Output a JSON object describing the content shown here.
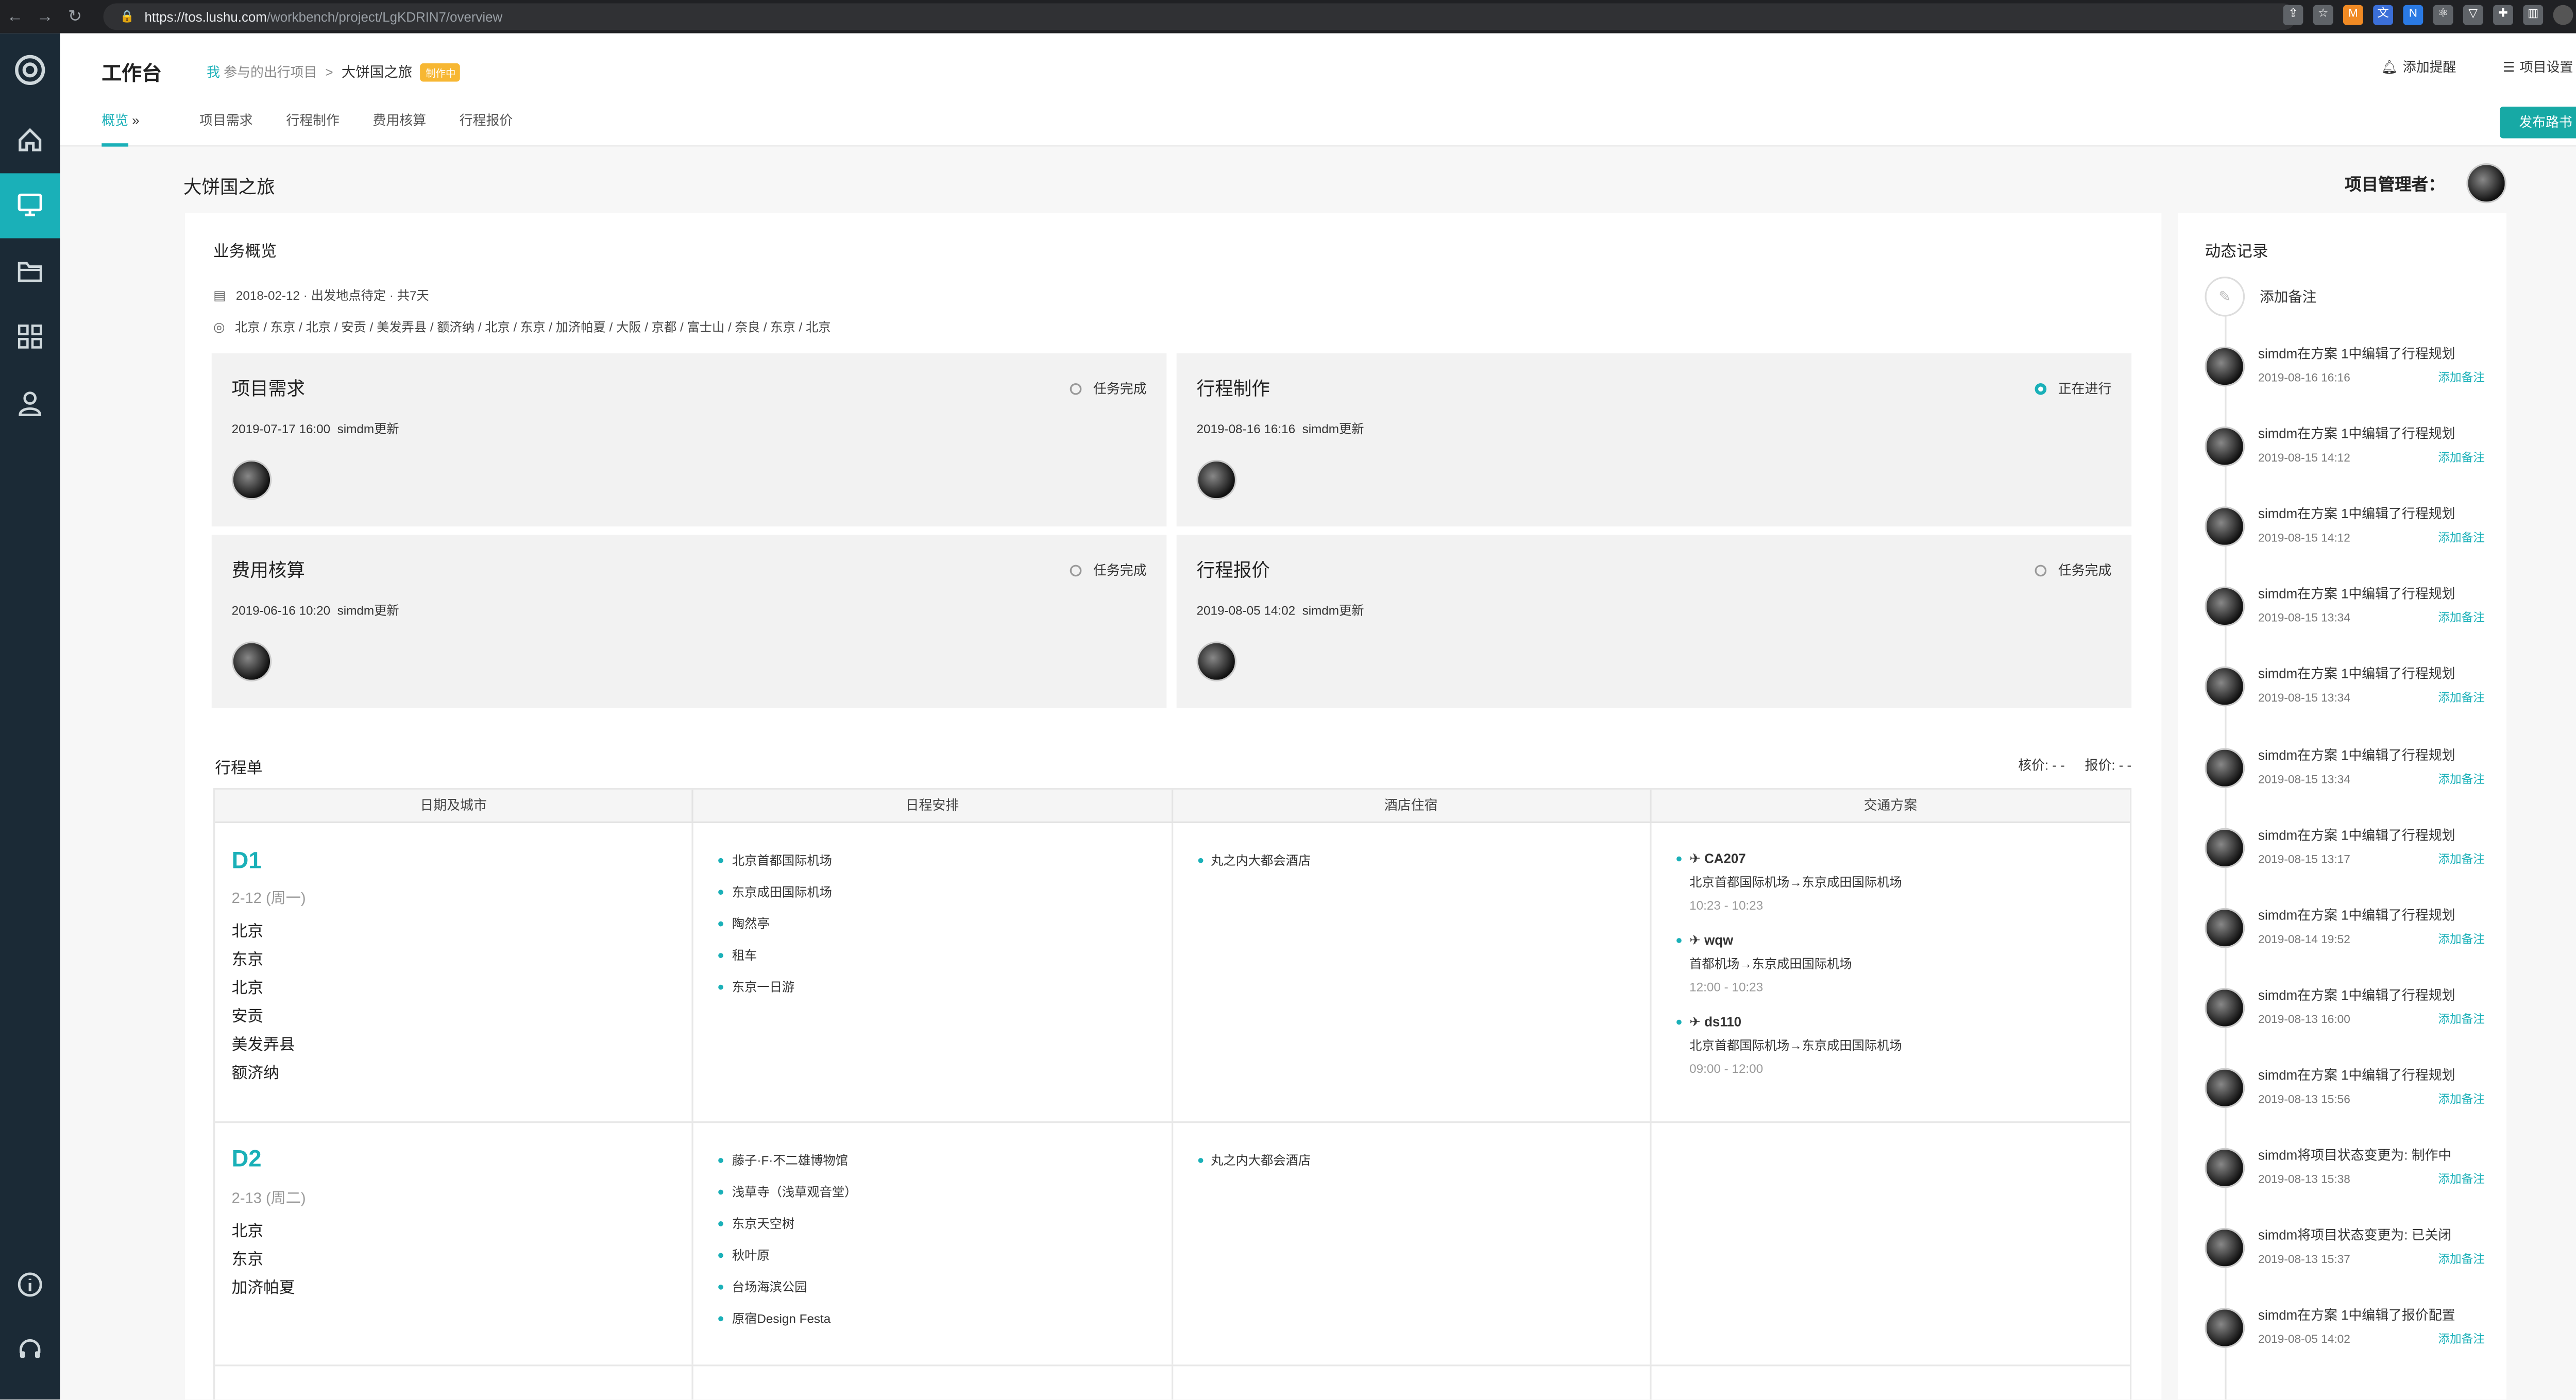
{
  "browser": {
    "url_host": "https://tos.lushu.com",
    "url_path": "/workbench/project/LgKDRIN7/overview"
  },
  "header": {
    "title": "工作台",
    "breadcrumb": {
      "me": "我",
      "parent": "参与的出行项目",
      "sep": ">",
      "current": "大饼国之旅",
      "status": "制作中"
    },
    "add_reminder": "添加提醒",
    "project_settings": "项目设置",
    "publish": "发布路书",
    "tabs": [
      "概览",
      "项目需求",
      "行程制作",
      "费用核算",
      "行程报价"
    ]
  },
  "project": {
    "title": "大饼国之旅",
    "manager_label": "项目管理者："
  },
  "overview": {
    "title": "业务概览",
    "date_line": "2018-02-12 · 出发地点待定 · 共7天",
    "route_line": "北京 / 东京 / 北京 / 安贡 / 美发弄县 / 额济纳 / 北京 / 东京 / 加济帕夏 / 大阪 / 京都 / 富士山 / 奈良 / 东京 / 北京"
  },
  "cards": [
    {
      "title": "项目需求",
      "status": "任务完成",
      "active": false,
      "updated": "2019-07-17 16:00",
      "by": "simdm更新"
    },
    {
      "title": "行程制作",
      "status": "正在进行",
      "active": true,
      "updated": "2019-08-16 16:16",
      "by": "simdm更新"
    },
    {
      "title": "费用核算",
      "status": "任务完成",
      "active": false,
      "updated": "2019-06-16 10:20",
      "by": "simdm更新"
    },
    {
      "title": "行程报价",
      "status": "任务完成",
      "active": false,
      "updated": "2019-08-05 14:02",
      "by": "simdm更新"
    }
  ],
  "itinerary": {
    "title": "行程单",
    "cost": "核价: - -",
    "quote": "报价: - -",
    "columns": [
      "日期及城市",
      "日程安排",
      "酒店住宿",
      "交通方案"
    ],
    "days": [
      {
        "label": "D1",
        "date": "2-12 (周一)",
        "cities": [
          "北京",
          "东京",
          "北京",
          "安贡",
          "美发弄县",
          "额济纳"
        ],
        "schedule": [
          "北京首都国际机场",
          "东京成田国际机场",
          "陶然亭",
          "租车",
          "东京一日游"
        ],
        "hotels": [
          "丸之内大都会酒店"
        ],
        "transport": [
          {
            "code": "CA207",
            "route": "北京首都国际机场→东京成田国际机场",
            "time": "10:23 - 10:23"
          },
          {
            "code": "wqw",
            "route": "首都机场→东京成田国际机场",
            "time": "12:00 - 10:23"
          },
          {
            "code": "ds110",
            "route": "北京首都国际机场→东京成田国际机场",
            "time": "09:00 - 12:00"
          }
        ]
      },
      {
        "label": "D2",
        "date": "2-13 (周二)",
        "cities": [
          "北京",
          "东京",
          "加济帕夏"
        ],
        "schedule": [
          "藤子·F·不二雄博物馆",
          "浅草寺（浅草观音堂）",
          "东京天空树",
          "秋叶原",
          "台场海滨公园",
          "原宿Design Festa"
        ],
        "hotels": [
          "丸之内大都会酒店"
        ],
        "transport": []
      }
    ]
  },
  "activity": {
    "title": "动态记录",
    "add_note": "添加备注",
    "note_link": "添加备注",
    "items": [
      {
        "text": "simdm在方案 1中编辑了行程规划",
        "time": "2019-08-16 16:16"
      },
      {
        "text": "simdm在方案 1中编辑了行程规划",
        "time": "2019-08-15 14:12"
      },
      {
        "text": "simdm在方案 1中编辑了行程规划",
        "time": "2019-08-15 14:12"
      },
      {
        "text": "simdm在方案 1中编辑了行程规划",
        "time": "2019-08-15 13:34"
      },
      {
        "text": "simdm在方案 1中编辑了行程规划",
        "time": "2019-08-15 13:34"
      },
      {
        "text": "simdm在方案 1中编辑了行程规划",
        "time": "2019-08-15 13:34"
      },
      {
        "text": "simdm在方案 1中编辑了行程规划",
        "time": "2019-08-15 13:17"
      },
      {
        "text": "simdm在方案 1中编辑了行程规划",
        "time": "2019-08-14 19:52"
      },
      {
        "text": "simdm在方案 1中编辑了行程规划",
        "time": "2019-08-13 16:00"
      },
      {
        "text": "simdm在方案 1中编辑了行程规划",
        "time": "2019-08-13 15:56"
      },
      {
        "text": "simdm将项目状态变更为: 制作中",
        "time": "2019-08-13 15:38"
      },
      {
        "text": "simdm将项目状态变更为: 已关闭",
        "time": "2019-08-13 15:37"
      },
      {
        "text": "simdm在方案 1中编辑了报价配置",
        "time": "2019-08-05 14:02"
      }
    ]
  },
  "colors": {
    "accent": "#1ab0b8",
    "sidebar": "#1b2a36",
    "badge": "#f7b733"
  }
}
